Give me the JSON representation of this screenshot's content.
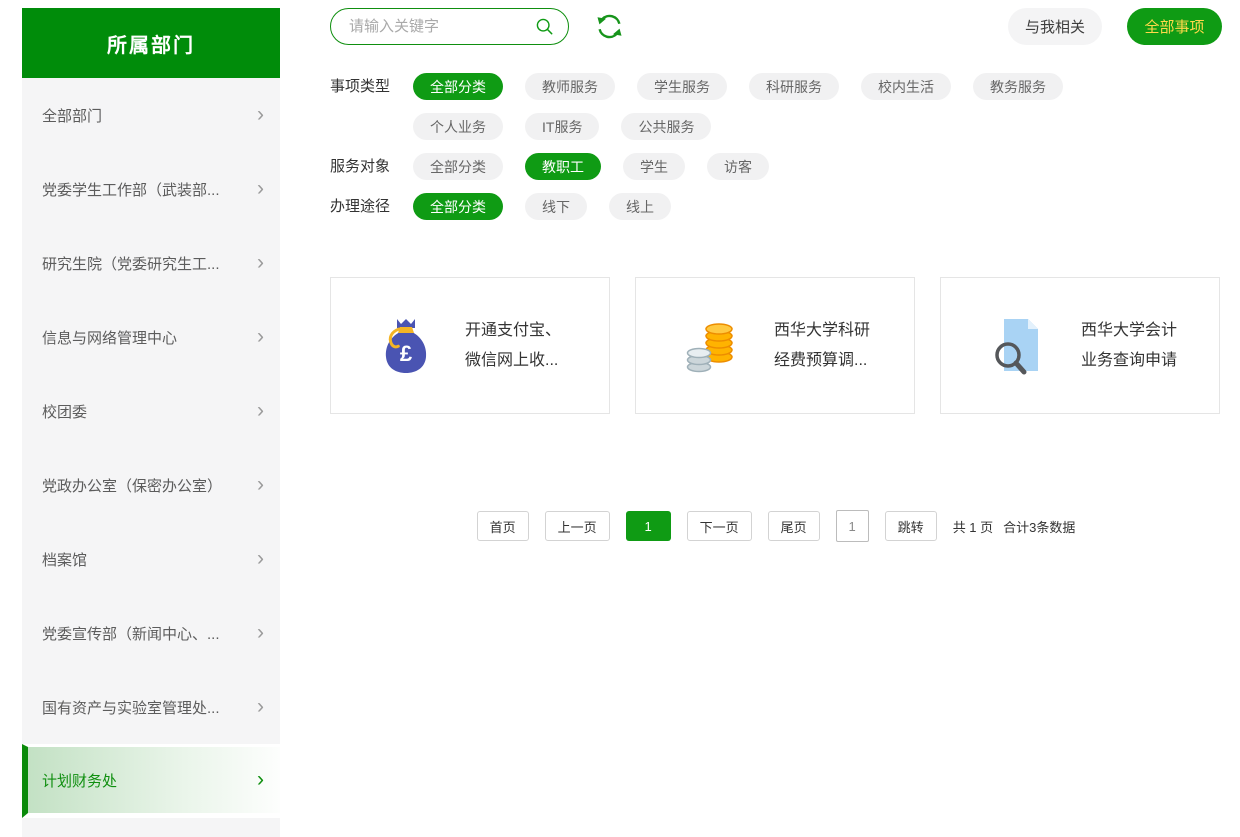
{
  "sidebar": {
    "title": "所属部门",
    "items": [
      {
        "label": "全部部门"
      },
      {
        "label": "党委学生工作部（武装部..."
      },
      {
        "label": "研究生院（党委研究生工..."
      },
      {
        "label": "信息与网络管理中心"
      },
      {
        "label": "校团委"
      },
      {
        "label": "党政办公室（保密办公室）"
      },
      {
        "label": "档案馆"
      },
      {
        "label": "党委宣传部（新闻中心、..."
      },
      {
        "label": "国有资产与实验室管理处..."
      },
      {
        "label": "计划财务处",
        "selected": true
      }
    ]
  },
  "topbar": {
    "search_placeholder": "请输入关键字",
    "related_button": "与我相关",
    "all_items_button": "全部事项"
  },
  "filters": [
    {
      "label": "事项类型",
      "options": [
        {
          "label": "全部分类",
          "selected": true
        },
        {
          "label": "教师服务"
        },
        {
          "label": "学生服务"
        },
        {
          "label": "科研服务"
        },
        {
          "label": "校内生活"
        },
        {
          "label": "教务服务"
        },
        {
          "label": "个人业务"
        },
        {
          "label": "IT服务"
        },
        {
          "label": "公共服务"
        }
      ]
    },
    {
      "label": "服务对象",
      "options": [
        {
          "label": "全部分类"
        },
        {
          "label": "教职工",
          "selected": true
        },
        {
          "label": "学生"
        },
        {
          "label": "访客"
        }
      ]
    },
    {
      "label": "办理途径",
      "options": [
        {
          "label": "全部分类",
          "selected": true
        },
        {
          "label": "线下"
        },
        {
          "label": "线上"
        }
      ]
    }
  ],
  "cards": [
    {
      "line1": "开通支付宝、",
      "line2": "微信网上收...",
      "icon": "money-bag-icon"
    },
    {
      "line1": "西华大学科研",
      "line2": "经费预算调...",
      "icon": "coins-icon"
    },
    {
      "line1": "西华大学会计",
      "line2": "业务查询申请",
      "icon": "document-search-icon"
    }
  ],
  "pagination": {
    "first": "首页",
    "prev": "上一页",
    "current": "1",
    "next": "下一页",
    "last": "尾页",
    "jump_value": "1",
    "jump_label": "跳转",
    "total_pages_text": "共 1 页",
    "total_records_text": "合计3条数据"
  },
  "colors": {
    "header_green": "#008c0a",
    "accent_green": "#0f9b14",
    "badge_text_yellow": "#ffd94a",
    "sidebar_panel_gray": "#f5f5f6"
  }
}
